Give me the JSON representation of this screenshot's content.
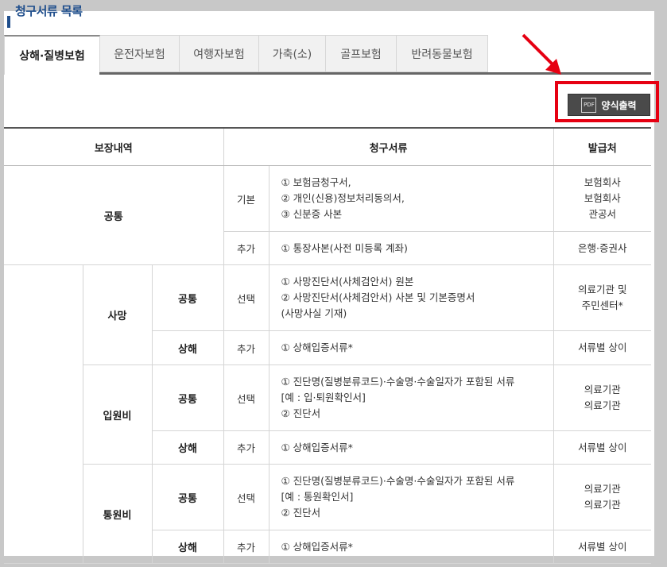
{
  "page": {
    "title": "청구서류 목록"
  },
  "tabs": [
    {
      "label": "상해·질병보험",
      "active": true
    },
    {
      "label": "운전자보험"
    },
    {
      "label": "여행자보험"
    },
    {
      "label": "가축(소)"
    },
    {
      "label": "골프보험"
    },
    {
      "label": "반려동물보험"
    }
  ],
  "pdf_button": {
    "icon_text": "PDF",
    "label": "양식출력"
  },
  "table": {
    "headers": {
      "coverage": "보장내역",
      "docs": "청구서류",
      "issuer": "발급처"
    },
    "common": {
      "label": "공통",
      "basic": {
        "type": "기본",
        "lines": [
          "① 보험금청구서,",
          "② 개인(신용)정보처리동의서,",
          "③ 신분증 사본"
        ],
        "issuers": [
          "보험회사",
          "보험회사",
          "관공서"
        ]
      },
      "extra": {
        "type": "추가",
        "lines": [
          "① 통장사본(사전 미등록 계좌)"
        ],
        "issuers": [
          "은행·증권사"
        ]
      }
    },
    "death": {
      "label": "사망",
      "common": {
        "label": "공통",
        "type": "선택",
        "lines": [
          "① 사망진단서(사체검안서) 원본",
          "② 사망진단서(사체검안서) 사본 및 기본증명서",
          "(사망사실 기재)"
        ],
        "issuers": [
          "의료기관 및",
          "주민센터*"
        ]
      },
      "injury": {
        "label": "상해",
        "type": "추가",
        "lines": [
          "① 상해입증서류*"
        ],
        "issuers": [
          "서류별 상이"
        ]
      }
    },
    "hospital": {
      "label": "입원비",
      "common": {
        "label": "공통",
        "type": "선택",
        "lines": [
          "① 진단명(질병분류코드)·수술명·수술일자가 포함된 서류",
          "[예 : 입·퇴원확인서]",
          "② 진단서"
        ],
        "issuers": [
          "의료기관",
          "의료기관"
        ]
      },
      "injury": {
        "label": "상해",
        "type": "추가",
        "lines": [
          "① 상해입증서류*"
        ],
        "issuers": [
          "서류별 상이"
        ]
      }
    },
    "outpatient": {
      "label": "통원비",
      "common": {
        "label": "공통",
        "type": "선택",
        "lines": [
          "① 진단명(질병분류코드)·수술명·수술일자가 포함된 서류",
          "[예 : 통원확인서]",
          "② 진단서"
        ],
        "issuers": [
          "의료기관",
          "의료기관"
        ]
      },
      "injury": {
        "label": "상해",
        "type": "추가",
        "lines": [
          "① 상해입증서류*"
        ],
        "issuers": [
          "서류별 상이"
        ]
      }
    }
  }
}
